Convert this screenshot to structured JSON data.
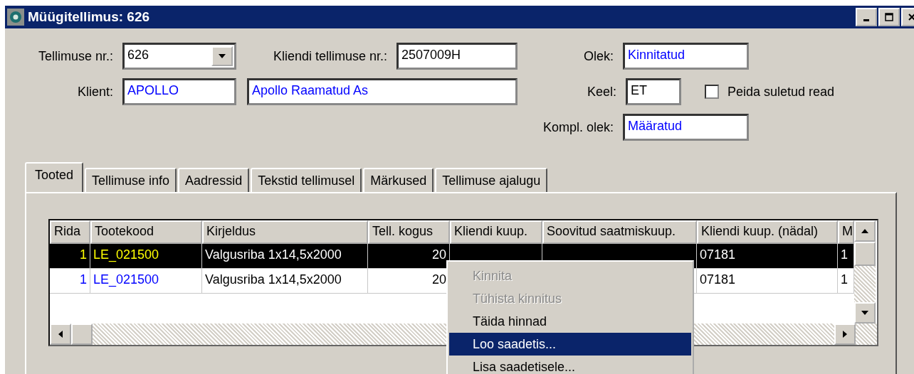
{
  "window": {
    "title": "Müügitellimus: 626"
  },
  "form": {
    "order_no": {
      "label": "Tellimuse nr.:",
      "value": "626"
    },
    "customer_order_no": {
      "label": "Kliendi tellimuse nr.:",
      "value": "2507009H"
    },
    "status": {
      "label": "Olek:",
      "value": "Kinnitatud"
    },
    "customer": {
      "label": "Klient:",
      "code": "APOLLO",
      "name": "Apollo Raamatud As"
    },
    "language": {
      "label": "Keel:",
      "value": "ET"
    },
    "hide_closed": {
      "label": "Peida suletud read",
      "checked": false
    },
    "kit_status": {
      "label": "Kompl. olek:",
      "value": "Määratud"
    }
  },
  "tabs": [
    {
      "label": "Tooted",
      "selected": true
    },
    {
      "label": "Tellimuse info",
      "selected": false
    },
    {
      "label": "Aadressid",
      "selected": false
    },
    {
      "label": "Tekstid tellimusel",
      "selected": false
    },
    {
      "label": "Märkused",
      "selected": false
    },
    {
      "label": "Tellimuse ajalugu",
      "selected": false
    }
  ],
  "table": {
    "columns": [
      "Rida",
      "Tootekood",
      "Kirjeldus",
      "Tell. kogus",
      "Kliendi kuup.",
      "Soovitud saatmiskuup.",
      "Kliendi kuup. (nädal)",
      "M"
    ],
    "rows": [
      {
        "selected": true,
        "row_no": "1",
        "code": "LE_021500",
        "description": "Valgusriba 1x14,5x2000",
        "qty": "20",
        "week": "07181",
        "column_8": "1"
      },
      {
        "selected": false,
        "row_no": "1",
        "code": "LE_021500",
        "description": "Valgusriba 1x14,5x2000",
        "qty": "20",
        "week": "07181",
        "column_8": "1"
      }
    ]
  },
  "context_menu": {
    "items": [
      {
        "label": "Kinnita",
        "disabled": true,
        "selected": false
      },
      {
        "label": "Tühista kinnitus",
        "disabled": true,
        "selected": false
      },
      {
        "label": "Täida hinnad",
        "disabled": false,
        "selected": false
      },
      {
        "label": "Loo saadetis...",
        "disabled": false,
        "selected": true
      },
      {
        "label": "Lisa saadetisele...",
        "disabled": false,
        "selected": false
      }
    ]
  }
}
